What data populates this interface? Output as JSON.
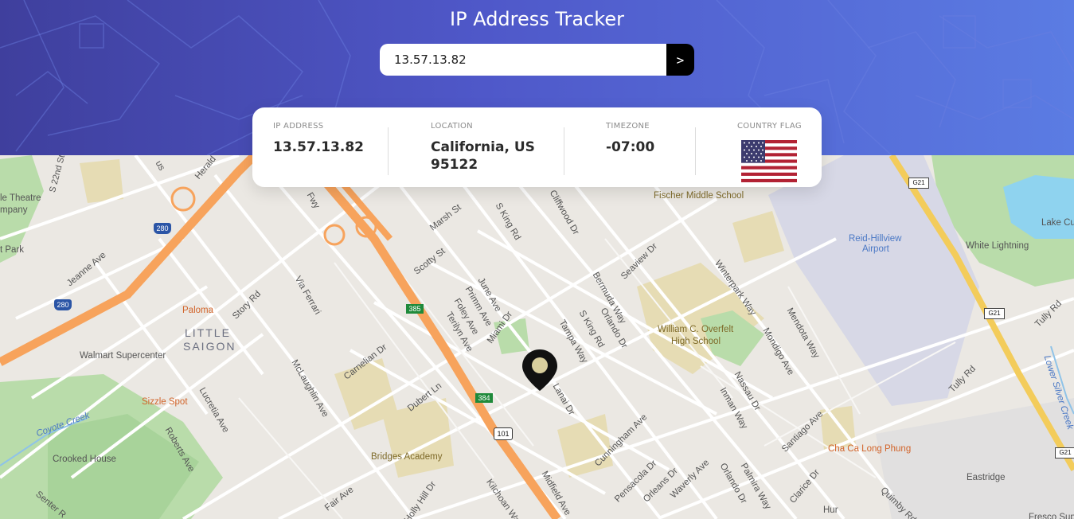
{
  "header": {
    "title": "IP Address Tracker"
  },
  "search": {
    "value": "13.57.13.82",
    "button_label": ">"
  },
  "info": {
    "ip": {
      "label": "IP ADDRESS",
      "value": "13.57.13.82"
    },
    "location": {
      "label": "LOCATION",
      "value": "California, US",
      "postal": "95122"
    },
    "timezone": {
      "label": "TIMEZONE",
      "value": "-07:00"
    },
    "flag": {
      "label": "COUNTRY FLAG",
      "icon": "us-flag-icon"
    }
  },
  "map": {
    "labels": {
      "theatre": "le Theatre",
      "mpany": "mpany",
      "park": "t Park",
      "s22nd": "S 22nd St",
      "jeanne": "Jeanne Ave",
      "paloma": "Paloma",
      "little": "LITTLE",
      "saigon": "SAIGON",
      "walmart": "Walmart Supercenter",
      "sizzle": "Sizzle Spot",
      "coyote": "Coyote Creek",
      "crooked": "Crooked House",
      "lucretia": "Lucretia Ave",
      "roberts": "Roberts Ave",
      "senter": "Senter R",
      "story": "Story Rd",
      "viaferrari": "Via Ferrari",
      "mclaughlin": "McLaughlin Ave",
      "carnelian": "Carnelian Dr",
      "dubert": "Dubert Ln",
      "bridges": "Bridges Academy",
      "fair": "Fair Ave",
      "hollyhill": "Holly Hill Dr",
      "kilchoan": "Kilchoan Way",
      "midfield": "Midfield Ave",
      "marsh": "Marsh St",
      "scotty": "Scotty St",
      "june": "June Ave",
      "primm": "Primm Ave",
      "foley": "Foley Ave",
      "terilyn": "Terilyn Ave",
      "miami": "Miami Dr",
      "tampa": "Tampa Way",
      "skingA": "S King Rd",
      "skingB": "S King Rd",
      "lanai": "Lanai Dr",
      "cliffwood": "Cliffwood Dr",
      "bermuda": "Bermuda Way",
      "orlando": "Orlando Dr",
      "seaview": "Seaview Dr",
      "fischer": "Fischer Middle School",
      "winterpark": "Winterpark Way",
      "overfelt1": "William C. Overfelt",
      "overfelt2": "High School",
      "mondigo": "Mondigo Ave",
      "mendota": "Mendota Way",
      "nassau": "Nassau Dr",
      "inman": "Inman Way",
      "cunningham": "Cunningham Ave",
      "pensacola": "Pensacola Dr",
      "orleans": "Orleans Dr",
      "waverly": "Waverly Ave",
      "orlando2": "Orlando Dr",
      "palmira": "Palmira Way",
      "clarice": "Clarice Dr",
      "santiago": "Santiago Ave",
      "chacha": "Cha Ca Long Phung",
      "reid1": "Reid-Hillview",
      "reid2": "Airport",
      "whitelight": "White Lightning",
      "lakecu": "Lake Cu",
      "tully1": "Tully Rd",
      "tully2": "Tully Rd",
      "quimby": "Quimby Rd",
      "eastridge": "Eastridge",
      "lowersilver": "Lower Silver Creek",
      "fresco": "Fresco Super",
      "hura": "Hur",
      "fwy": "Fwy",
      "herald": "Herald",
      "us": "us"
    },
    "shields": {
      "i280a": "280",
      "i280b": "280",
      "r385": "385",
      "r384": "384",
      "us101": "101",
      "g21a": "G21",
      "g21b": "G21",
      "g21c": "G21"
    }
  }
}
